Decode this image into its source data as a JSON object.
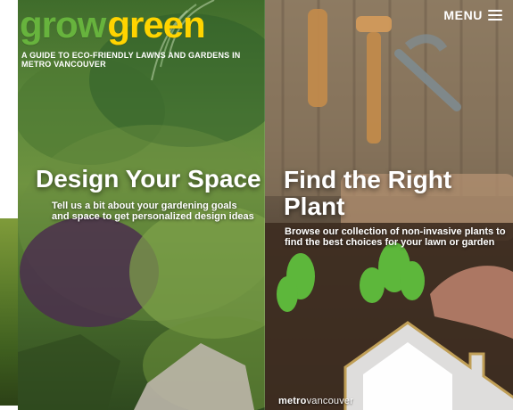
{
  "brand": {
    "part1": "grow",
    "part2": "green"
  },
  "tagline": "A GUIDE TO ECO-FRIENDLY LAWNS AND GARDENS IN METRO VANCOUVER",
  "menu": {
    "label": "MENU",
    "icon": "hamburger-menu-icon"
  },
  "design": {
    "title": "Design Your Space",
    "description": "Tell us a bit about your gardening goals and space to get personalized design ideas"
  },
  "plant": {
    "title": "Find the Right Plant",
    "description": "Browse our collection of non-invasive plants to find the best choices for your lawn or garden"
  },
  "footer": {
    "part1": "metro",
    "part2": "vancouver"
  },
  "colors": {
    "brand_grow": "#67b33d",
    "brand_green": "#ffd400",
    "text": "#ffffff"
  }
}
